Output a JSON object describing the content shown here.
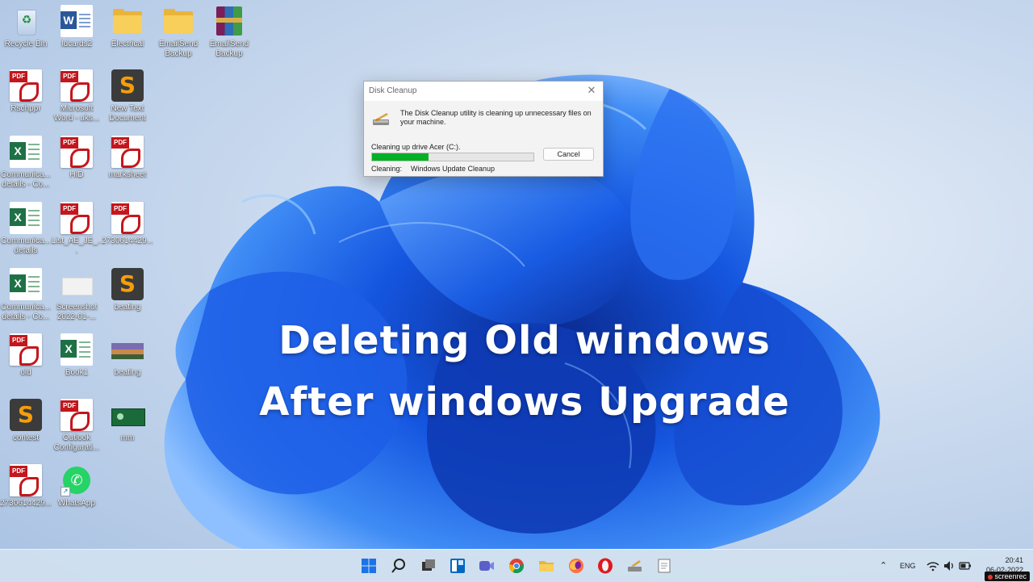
{
  "desktop": {
    "icons": [
      {
        "label": "Recycle Bin",
        "icon": "recycle-bin-icon"
      },
      {
        "label": "Idcards2",
        "icon": "word-document-icon"
      },
      {
        "label": "Electrical",
        "icon": "folder-icon"
      },
      {
        "label": "EmailSend Backup",
        "icon": "folder-icon"
      },
      {
        "label": "EmailSend Backup",
        "icon": "winrar-archive-icon"
      },
      {
        "label": "Rschppr",
        "icon": "pdf-icon"
      },
      {
        "label": "Microsoft Word - uks...",
        "icon": "pdf-icon"
      },
      {
        "label": "New Text Document",
        "icon": "sublime-text-icon"
      },
      {
        "label": "Communica... details - Co...",
        "icon": "excel-icon"
      },
      {
        "label": "HID",
        "icon": "pdf-icon"
      },
      {
        "label": "marksheet",
        "icon": "pdf-icon"
      },
      {
        "label": "Communica... details",
        "icon": "excel-icon"
      },
      {
        "label": "List_AE_JE_...",
        "icon": "pdf-icon"
      },
      {
        "label": "2730614429...",
        "icon": "pdf-icon"
      },
      {
        "label": "Communica... details - Co...",
        "icon": "excel-icon"
      },
      {
        "label": "Screenshot 2022-01-...",
        "icon": "screenshot-image-icon"
      },
      {
        "label": "beating",
        "icon": "sublime-text-icon"
      },
      {
        "label": "old",
        "icon": "pdf-icon"
      },
      {
        "label": "Book1",
        "icon": "excel-icon"
      },
      {
        "label": "beating",
        "icon": "photo-icon"
      },
      {
        "label": "contest",
        "icon": "sublime-text-icon"
      },
      {
        "label": "Outlook Configurati...",
        "icon": "pdf-icon"
      },
      {
        "label": "mm",
        "icon": "image-icon"
      },
      {
        "label": "2730614429...",
        "icon": "pdf-icon"
      },
      {
        "label": "WhatsApp",
        "icon": "whatsapp-icon"
      }
    ],
    "pdf_tag": "PDF",
    "word_letter": "W",
    "excel_letter": "X",
    "sublime_letter": "S"
  },
  "dialog": {
    "title": "Disk Cleanup",
    "message": "The Disk Cleanup utility is cleaning up unnecessary files on your machine.",
    "drive_status": "Cleaning up drive Acer (C:).",
    "progress_fraction": 0.35,
    "cancel_label": "Cancel",
    "cleaning_label": "Cleaning:",
    "cleaning_value": "Windows Update Cleanup",
    "close_glyph": "✕"
  },
  "overlay": {
    "line1": "Deleting Old windows",
    "line2": "After windows Upgrade"
  },
  "taskbar": {
    "apps": [
      "start-icon",
      "search-icon",
      "task-view-icon",
      "widgets-icon",
      "teams-chat-icon",
      "chrome-icon",
      "file-explorer-icon",
      "firefox-icon",
      "opera-icon",
      "disk-cleanup-icon",
      "notepad-icon"
    ],
    "tray": {
      "chevron": "⌃",
      "language": "ENG",
      "time": "20:41",
      "date": "06-02-2022"
    }
  },
  "watermark": {
    "brand": "screenrec"
  },
  "colors": {
    "accent": "#0a5cd8",
    "progress": "#06b025",
    "pdf_red": "#c4161c",
    "excel_green": "#1e7145",
    "word_blue": "#2b579a"
  }
}
